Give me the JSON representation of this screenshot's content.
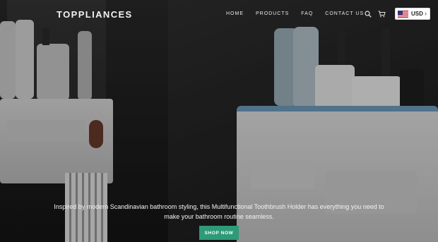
{
  "header": {
    "brand": "TOPPLIANCES",
    "nav": [
      {
        "label": "HOME"
      },
      {
        "label": "PRODUCTS"
      },
      {
        "label": "FAQ"
      },
      {
        "label": "CONTACT US"
      }
    ],
    "search_icon": "search-icon",
    "cart_icon": "cart-icon",
    "currency": {
      "selected": "USD",
      "flag": "us-flag-icon"
    }
  },
  "hero": {
    "caption": "Inspired by modern Scandinavian bathroom styling, this Multifunctional Toothbrush Holder has everything you need to make your bathroom routine seamless.",
    "cta_label": "SHOP NOW",
    "cta_color": "#2e9a77"
  }
}
